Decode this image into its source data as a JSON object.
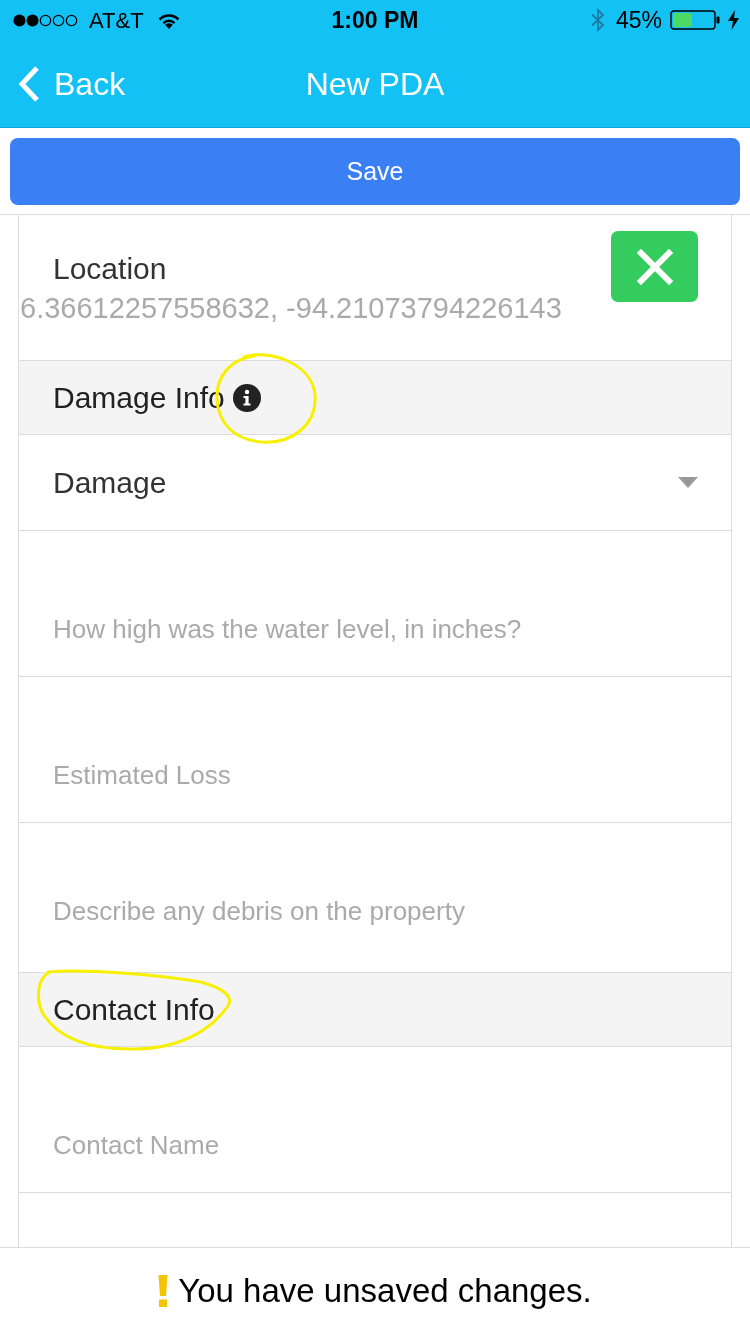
{
  "status_bar": {
    "carrier": "AT&T",
    "time": "1:00 PM",
    "battery": "45%"
  },
  "nav_bar": {
    "back": "Back",
    "title": "New PDA"
  },
  "save_button": {
    "label": "Save"
  },
  "form": {
    "rows": [
      {
        "kind": "location",
        "label": "Location",
        "value": "6.36612257558632, -94.21073794226143"
      },
      {
        "kind": "header",
        "title": "Damage Info",
        "info": true,
        "circled": true
      },
      {
        "kind": "select",
        "label": "Damage"
      },
      {
        "kind": "input",
        "placeholder": "How high was the water level, in inches?"
      },
      {
        "kind": "input",
        "placeholder": "Estimated Loss"
      },
      {
        "kind": "textarea",
        "placeholder": "Describe any debris on the property"
      },
      {
        "kind": "header",
        "title": "Contact Info",
        "info": false,
        "circled": true
      },
      {
        "kind": "input",
        "placeholder": "Contact Name"
      }
    ]
  },
  "footer": {
    "message": "You have unsaved changes."
  }
}
